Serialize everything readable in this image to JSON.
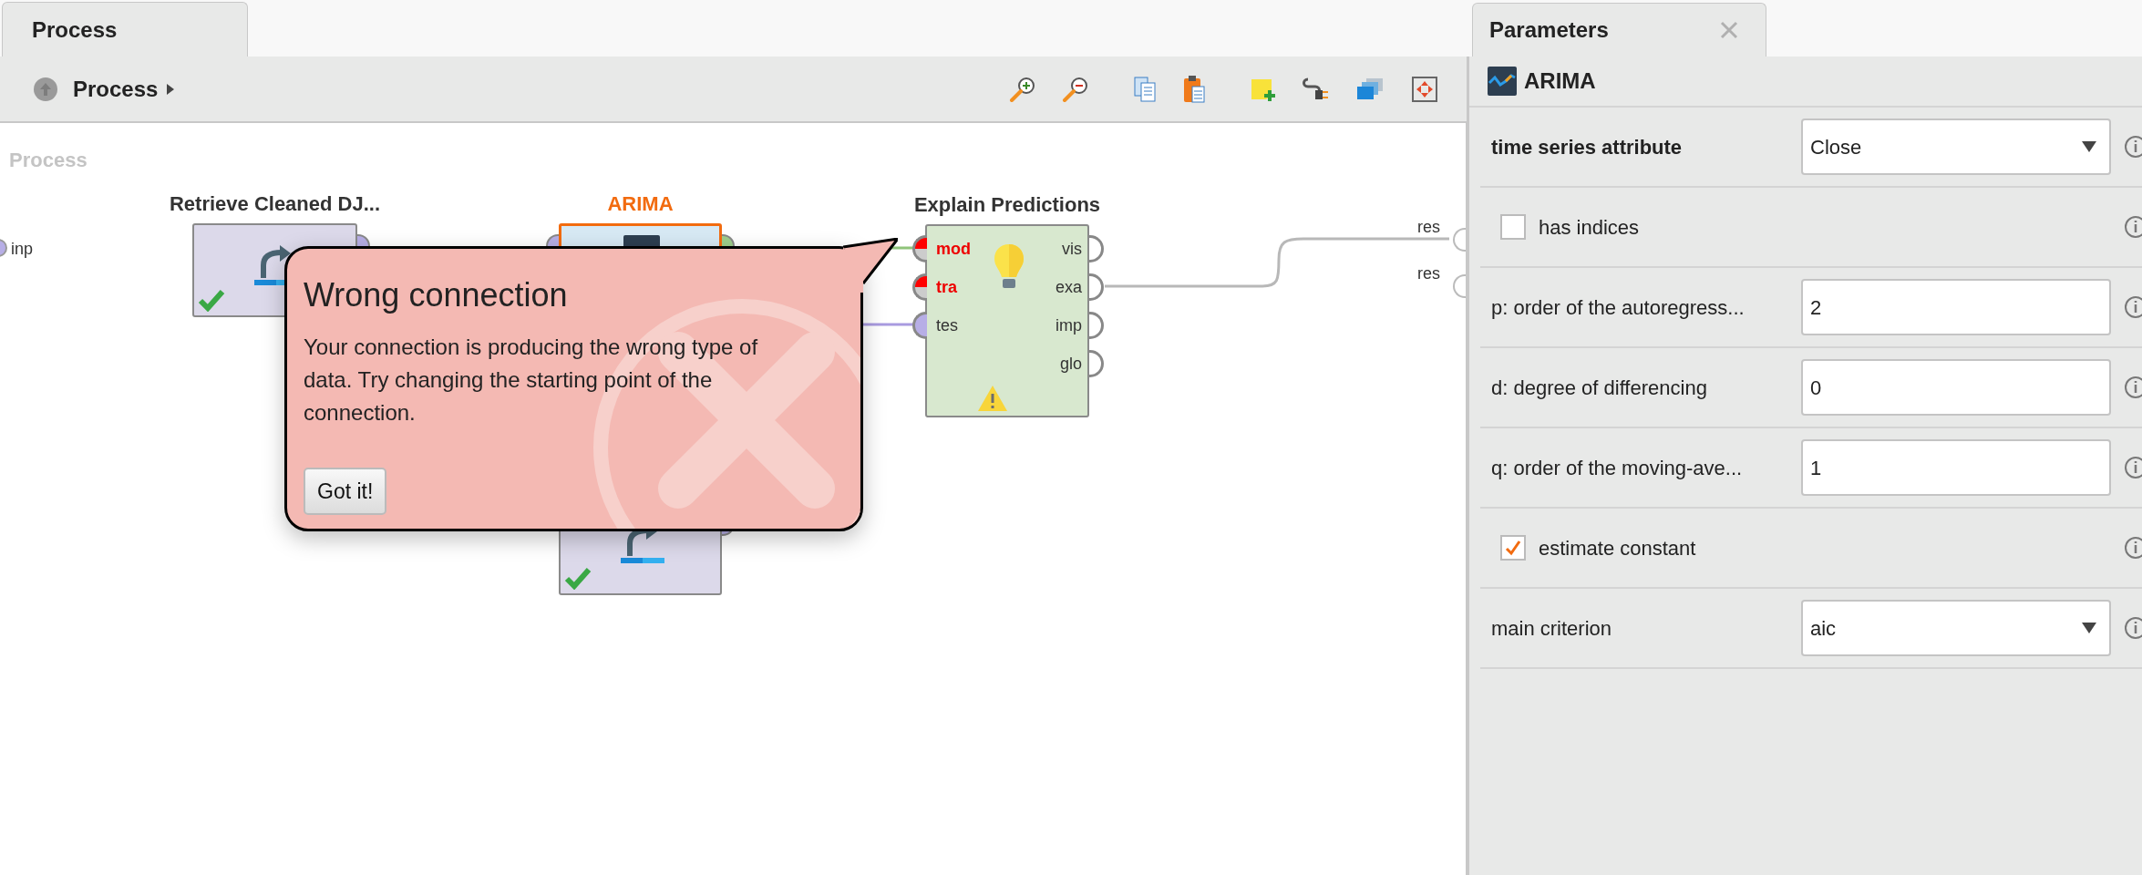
{
  "process_tab": {
    "label": "Process",
    "selected": true
  },
  "breadcrumb": {
    "label": "Process"
  },
  "canvas": {
    "title": "Process",
    "input_ports": [
      {
        "label": "inp"
      }
    ],
    "output_ports": [
      {
        "label": "res"
      },
      {
        "label": "res"
      }
    ],
    "operators": [
      {
        "kind": "retrieve",
        "title": "Retrieve Cleaned DJ...",
        "selected": false,
        "executed": true,
        "warning": false
      },
      {
        "kind": "arima",
        "title": "ARIMA",
        "selected": true,
        "executed": false,
        "warning": false
      },
      {
        "kind": "retrieve",
        "selected": false,
        "executed": true,
        "warning": false
      },
      {
        "kind": "explain",
        "title": "Explain Predictions",
        "selected": false,
        "executed": false,
        "warning": true,
        "inputs": [
          {
            "label": "mod",
            "error": true
          },
          {
            "label": "tra",
            "error": true
          },
          {
            "label": "tes",
            "error": false
          }
        ],
        "outputs": [
          {
            "label": "vis"
          },
          {
            "label": "exa"
          },
          {
            "label": "imp"
          },
          {
            "label": "glo"
          }
        ]
      }
    ]
  },
  "popup": {
    "title": "Wrong connection",
    "message": "Your connection is producing the wrong type of data. Try changing the starting point of the connection.",
    "button": "Got it!"
  },
  "parameters": {
    "tab": {
      "label": "Parameters",
      "selected": true
    },
    "operator": "ARIMA",
    "params": [
      {
        "kind": "dropdown",
        "label": "time series attribute",
        "required": true,
        "value": "Close"
      },
      {
        "kind": "checkbox",
        "label": "has indices",
        "required": false,
        "checked": false
      },
      {
        "kind": "text",
        "label": "p: order of the autoregress...",
        "required": false,
        "value": "2"
      },
      {
        "kind": "text",
        "label": "d: degree of differencing",
        "required": false,
        "value": "0"
      },
      {
        "kind": "text",
        "label": "q: order of the moving-ave...",
        "required": false,
        "value": "1"
      },
      {
        "kind": "checkbox",
        "label": "estimate constant",
        "required": false,
        "checked": true
      },
      {
        "kind": "dropdown",
        "label": "main criterion",
        "required": false,
        "value": "aic"
      }
    ]
  }
}
